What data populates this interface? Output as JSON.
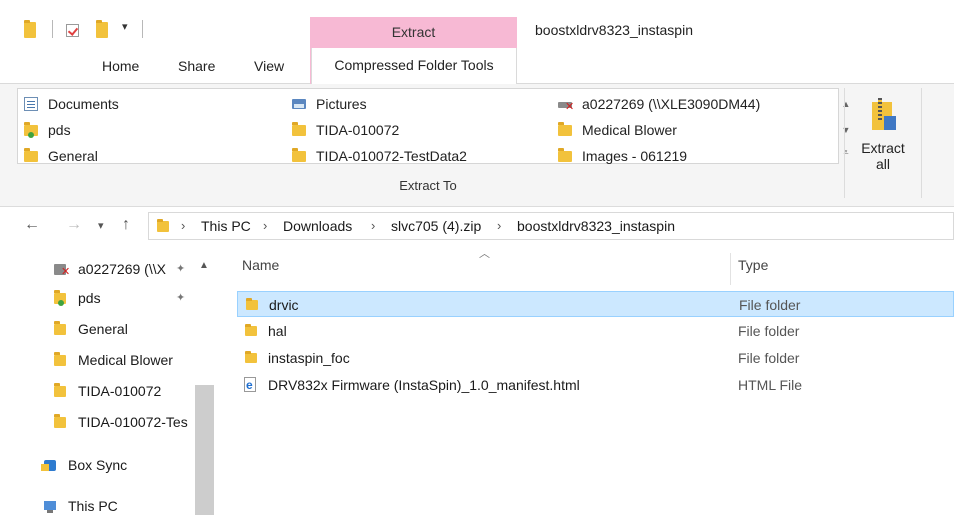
{
  "window": {
    "title": "boostxldrv8323_instaspin"
  },
  "ribbon_tabs": {
    "context_group": "Extract",
    "home": "Home",
    "share": "Share",
    "view": "View",
    "compressed_folder_tools": "Compressed Folder Tools"
  },
  "extract_gallery": {
    "items": [
      {
        "label": "Documents",
        "icon": "documents-icon"
      },
      {
        "label": "pds",
        "icon": "pds-folder-icon"
      },
      {
        "label": "General",
        "icon": "folder-icon"
      },
      {
        "label": "Pictures",
        "icon": "pictures-icon"
      },
      {
        "label": "TIDA-010072",
        "icon": "folder-icon"
      },
      {
        "label": "TIDA-010072-TestData2",
        "icon": "folder-icon"
      },
      {
        "label": "a0227269 (\\\\XLE3090DM44)",
        "icon": "network-drive-disconnected-icon"
      },
      {
        "label": "Medical Blower",
        "icon": "folder-icon"
      },
      {
        "label": "Images - 061219",
        "icon": "folder-icon"
      }
    ],
    "group_label": "Extract To"
  },
  "extract_all": {
    "label_line1": "Extract",
    "label_line2": "all"
  },
  "address": {
    "crumbs": [
      "This PC",
      "Downloads",
      "slvc705 (4).zip",
      "boostxldrv8323_instaspin"
    ]
  },
  "nav_pane": {
    "items": [
      {
        "label": "a0227269 (\\\\X",
        "icon": "network-drive-disconnected-icon",
        "pinned": true
      },
      {
        "label": "pds",
        "icon": "pds-folder-icon",
        "pinned": true
      },
      {
        "label": "General",
        "icon": "folder-icon",
        "pinned": false
      },
      {
        "label": "Medical Blower",
        "icon": "folder-icon",
        "pinned": false
      },
      {
        "label": "TIDA-010072",
        "icon": "folder-icon",
        "pinned": false
      },
      {
        "label": "TIDA-010072-Tes",
        "icon": "folder-icon",
        "pinned": false
      },
      {
        "label": "Box Sync",
        "icon": "box-sync-icon",
        "pinned": false
      },
      {
        "label": "This PC",
        "icon": "this-pc-icon",
        "pinned": false
      }
    ]
  },
  "file_list": {
    "columns": {
      "name": "Name",
      "type": "Type"
    },
    "rows": [
      {
        "name": "drvic",
        "type": "File folder",
        "icon": "folder-icon",
        "selected": true
      },
      {
        "name": "hal",
        "type": "File folder",
        "icon": "folder-icon",
        "selected": false
      },
      {
        "name": "instaspin_foc",
        "type": "File folder",
        "icon": "folder-icon",
        "selected": false
      },
      {
        "name": "DRV832x Firmware (InstaSpin)_1.0_manifest.html",
        "type": "HTML File",
        "icon": "html-file-icon",
        "selected": false
      }
    ]
  },
  "colors": {
    "context_tab": "#f7b9d4",
    "selection": "#cce8ff",
    "folder": "#f2c23c"
  }
}
